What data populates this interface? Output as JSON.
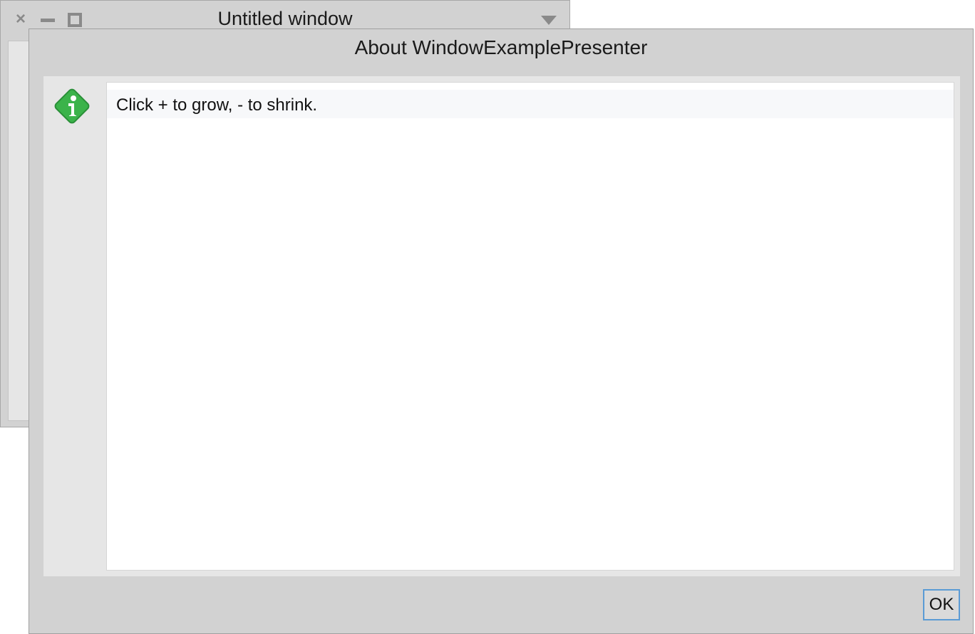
{
  "background_window": {
    "title": "Untitled window",
    "close_glyph": "×",
    "icons": [
      "close-icon",
      "minimize-icon",
      "maximize-icon",
      "menu-arrow-icon"
    ]
  },
  "dialog": {
    "title": "About WindowExamplePresenter",
    "icon": "info-icon",
    "icon_color": "#3bb34a",
    "message": "Click + to grow, - to shrink.",
    "ok_label": "OK",
    "accent_color": "#5b9bd5"
  }
}
